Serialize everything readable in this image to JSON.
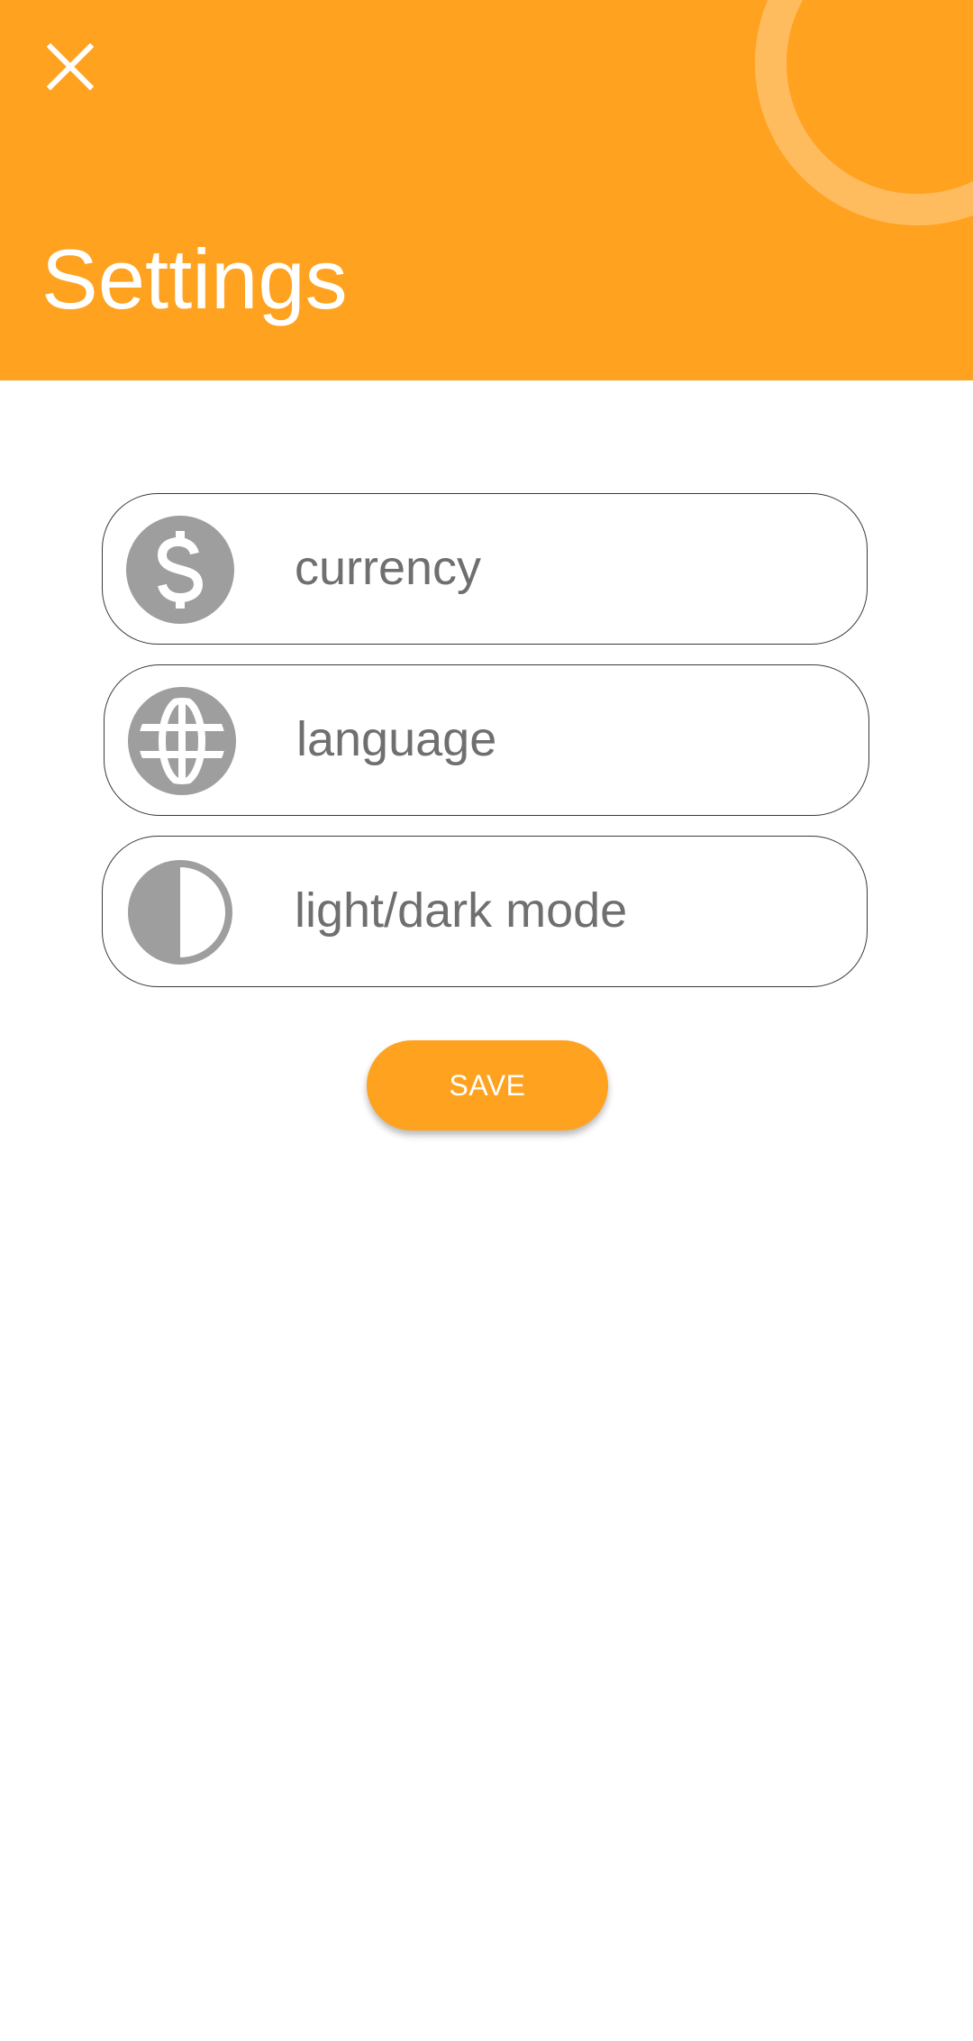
{
  "header": {
    "title": "Settings",
    "close_icon": "close-icon",
    "background_color": "#FFA220"
  },
  "settings": {
    "options": [
      {
        "label": "currency",
        "icon": "dollar-icon"
      },
      {
        "label": "language",
        "icon": "globe-icon"
      },
      {
        "label": "light/dark mode",
        "icon": "contrast-icon"
      }
    ]
  },
  "actions": {
    "save_label": "SAVE",
    "save_color": "#FFA220"
  },
  "colors": {
    "icon_gray": "#9E9E9E",
    "label_gray": "#6F6F6F"
  }
}
